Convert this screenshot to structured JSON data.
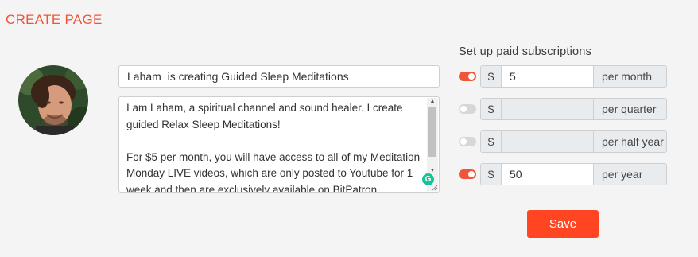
{
  "page": {
    "title": "CREATE PAGE"
  },
  "profile": {
    "title_value": "Laham  is creating Guided Sleep Meditations",
    "description_value": "I am Laham, a spiritual channel and sound healer. I create guided Relax Sleep Meditations!\n\nFor $5 per month, you will have access to all of my Meditation Monday LIVE videos, which are only posted to Youtube for 1 week and then are exclusively available on BitPatron."
  },
  "subscriptions": {
    "heading": "Set up paid subscriptions",
    "currency_symbol": "$",
    "rows": [
      {
        "enabled": true,
        "amount": "5",
        "period": "per month"
      },
      {
        "enabled": false,
        "amount": "",
        "period": "per quarter"
      },
      {
        "enabled": false,
        "amount": "",
        "period": "per half year"
      },
      {
        "enabled": true,
        "amount": "50",
        "period": "per year"
      }
    ]
  },
  "actions": {
    "save_label": "Save"
  },
  "colors": {
    "accent": "#f0553a",
    "save_button": "#ff4522",
    "toggle_off": "#d7d7d7"
  }
}
